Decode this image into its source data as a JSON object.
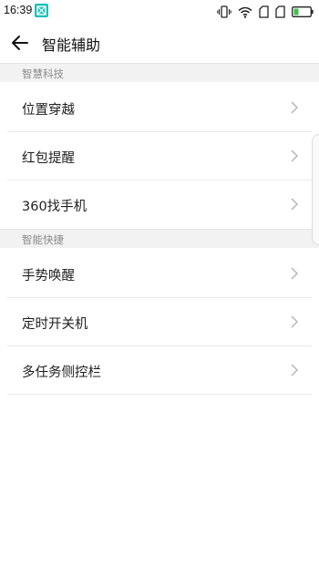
{
  "status_bar": {
    "time": "16:39",
    "app_badge_color": "#19c0b8",
    "icons": [
      "vibrate-icon",
      "wifi-icon",
      "sim1-icon",
      "sim2-icon",
      "battery-icon"
    ]
  },
  "header": {
    "back_icon": "back-arrow-icon",
    "title": "智能辅助"
  },
  "sections": [
    {
      "title": "智慧科技",
      "items": [
        {
          "label": "位置穿越"
        },
        {
          "label": "红包提醒"
        },
        {
          "label": "360找手机"
        }
      ]
    },
    {
      "title": "智能快捷",
      "items": [
        {
          "label": "手势唤醒"
        },
        {
          "label": "定时开关机"
        },
        {
          "label": "多任务侧控栏"
        }
      ]
    }
  ],
  "colors": {
    "section_bg": "#f2f2f2",
    "chevron": "#b3b3b3",
    "battery_fill": "#3ec24a"
  }
}
